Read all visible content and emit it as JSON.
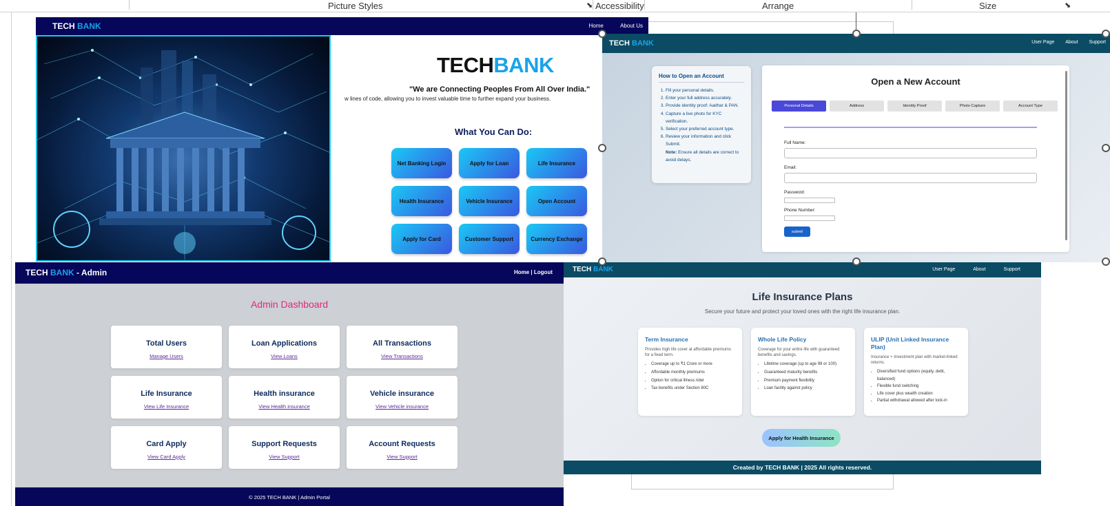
{
  "ribbon": {
    "groups": [
      "Picture Styles",
      "Accessibility",
      "Arrange",
      "Size"
    ]
  },
  "panel_home": {
    "brand_a": "TECH",
    "brand_b": "BANK",
    "nav": [
      "Home",
      "About Us"
    ],
    "logo_a": "TECH",
    "logo_b": "BANK",
    "tagline": "\"We are Connecting Peoples From All Over India.\"",
    "description": "w lines of code, allowing you to invest valuable time to further expand your business.",
    "section_title": "What You Can Do:",
    "services": [
      "Net Banking Login",
      "Apply for Loan",
      "Life Insurance",
      "Health Insurance",
      "Vehicle Insurance",
      "Open Account",
      "Apply for Card",
      "Customer Support",
      "Currency Exchange"
    ]
  },
  "panel_account": {
    "brand_a": "TECH",
    "brand_b": "BANK",
    "nav": [
      "User Page",
      "About",
      "Support"
    ],
    "howto_title": "How to Open an Account",
    "steps": [
      "Fill your personal details.",
      "Enter your full address accurately.",
      "Provide identity proof: Aadhar & PAN.",
      "Capture a live photo for KYC verification.",
      "Select your preferred account type.",
      "Review your information and click Submit."
    ],
    "note_label": "Note:",
    "note_text": "Ensure all details are correct to avoid delays.",
    "form_title": "Open a New Account",
    "tabs": [
      "Personal Details",
      "Address",
      "Identity Proof",
      "Photo Capture",
      "Account Type"
    ],
    "fields": {
      "full_name": "Full Name:",
      "email": "Email:",
      "password": "Password:",
      "phone": "Phone Number:"
    },
    "submit": "submit"
  },
  "panel_admin": {
    "brand_a": "TECH",
    "brand_b": "BANK",
    "brand_c": "- Admin",
    "nav": "Home | Logout",
    "title": "Admin Dashboard",
    "cards": [
      {
        "title": "Total Users",
        "link": "Manage Users"
      },
      {
        "title": "Loan Applications",
        "link": "View Loans"
      },
      {
        "title": "All Transactions",
        "link": "View Transactions"
      },
      {
        "title": "Life Insurance",
        "link": "View Life Insurance"
      },
      {
        "title": "Health insurance",
        "link": "View Health insurance"
      },
      {
        "title": "Vehicle insurance",
        "link": "View Vehicle insurance"
      },
      {
        "title": "Card Apply",
        "link": "View Card Apply"
      },
      {
        "title": "Support Requests",
        "link": "View Support"
      },
      {
        "title": "Account Requests",
        "link": "View Support"
      }
    ],
    "footer": "© 2025 TECH BANK | Admin Portal"
  },
  "panel_life": {
    "brand_a": "TECH",
    "brand_b": "BANK",
    "nav": [
      "User Page",
      "About",
      "Support"
    ],
    "title": "Life Insurance Plans",
    "subtitle": "Secure your future and protect your loved ones with the right life insurance plan.",
    "plans": [
      {
        "name": "Term Insurance",
        "desc": "Provides high life cover at affordable premiums for a fixed term.",
        "points": [
          "Coverage up to ₹1 Crore or more",
          "Affordable monthly premiums",
          "Option for critical illness rider",
          "Tax benefits under Section 80C"
        ]
      },
      {
        "name": "Whole Life Policy",
        "desc": "Coverage for your entire life with guaranteed benefits and savings.",
        "points": [
          "Lifetime coverage (up to age 99 or 100)",
          "Guaranteed maturity benefits",
          "Premium payment flexibility",
          "Loan facility against policy"
        ]
      },
      {
        "name": "ULIP (Unit Linked Insurance Plan)",
        "desc": "Insurance + Investment plan with market-linked returns.",
        "points": [
          "Diversified fund options (equity, debt, balanced)",
          "Flexible fund switching",
          "Life cover plus wealth creation",
          "Partial withdrawal allowed after lock-in"
        ]
      }
    ],
    "apply_button": "Apply for Health Insurance",
    "footer": "Created by TECH BANK | 2025 All rights reserved."
  }
}
